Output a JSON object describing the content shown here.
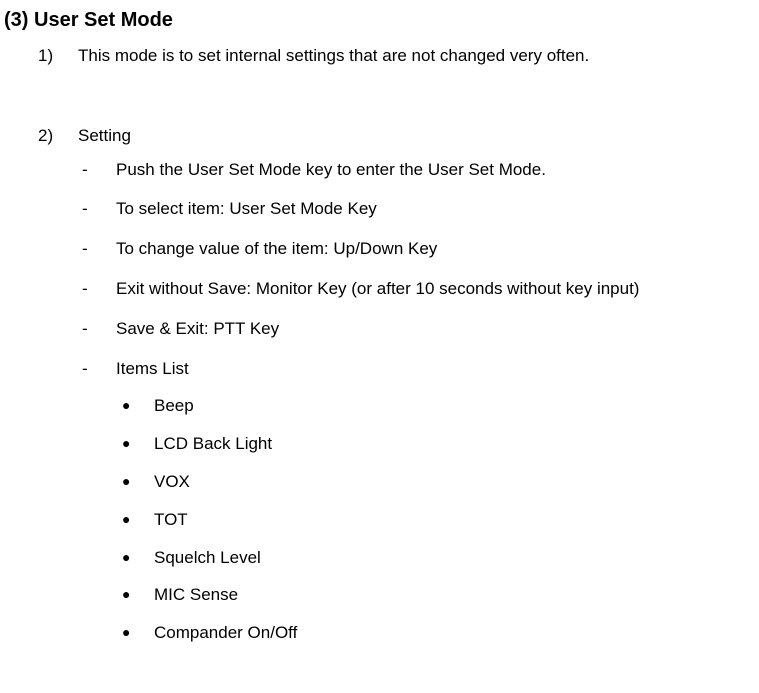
{
  "heading": "(3) User Set Mode",
  "items": [
    {
      "num": "1)",
      "text": "This mode is to set internal settings that are not changed very often."
    },
    {
      "num": "2)",
      "text": "Setting",
      "sub": [
        {
          "text": "Push the User Set Mode key to enter the User Set Mode."
        },
        {
          "text": "To select item: User Set Mode Key"
        },
        {
          "text": "To change value of the item: Up/Down Key"
        },
        {
          "text": "Exit without Save: Monitor Key (or after 10 seconds without key input)"
        },
        {
          "text": "Save & Exit: PTT Key"
        },
        {
          "text": "Items List",
          "bullets": [
            "Beep",
            "LCD Back Light",
            "VOX",
            "TOT",
            "Squelch Level",
            "MIC Sense",
            "Compander On/Off"
          ]
        }
      ]
    }
  ],
  "markers": {
    "dash": "-",
    "bullet": "●"
  }
}
